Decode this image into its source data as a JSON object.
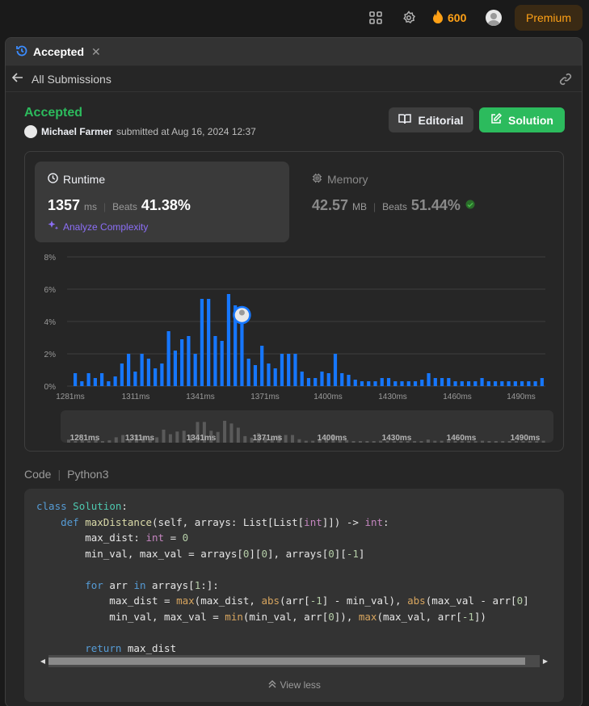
{
  "nav": {
    "streak_count": "600",
    "premium_label": "Premium"
  },
  "tab": {
    "title": "Accepted",
    "close": "✕"
  },
  "subbar": {
    "back_label": "All Submissions"
  },
  "submission": {
    "status": "Accepted",
    "user": "Michael Farmer",
    "submitted_text": "submitted at Aug 16, 2024 12:37"
  },
  "buttons": {
    "editorial": "Editorial",
    "solution": "Solution"
  },
  "runtime": {
    "label": "Runtime",
    "value": "1357",
    "unit": "ms",
    "beats_label": "Beats",
    "beats_value": "41.38%",
    "analyze": "Analyze Complexity"
  },
  "memory": {
    "label": "Memory",
    "value": "42.57",
    "unit": "MB",
    "beats_label": "Beats",
    "beats_value": "51.44%"
  },
  "chart_data": {
    "type": "bar",
    "x_tick_labels": [
      "1281ms",
      "1311ms",
      "1341ms",
      "1371ms",
      "1400ms",
      "1430ms",
      "1460ms",
      "1490ms"
    ],
    "y_tick_labels": [
      "0%",
      "2%",
      "4%",
      "6%",
      "8%"
    ],
    "ylim": [
      0,
      8
    ],
    "values": [
      0.8,
      0.3,
      0.8,
      0.5,
      0.8,
      0.3,
      0.6,
      1.4,
      2.0,
      0.9,
      2.0,
      1.7,
      1.1,
      1.4,
      3.4,
      2.2,
      2.9,
      3.1,
      2.0,
      5.4,
      5.4,
      3.1,
      2.8,
      5.7,
      5.0,
      3.9,
      1.7,
      1.3,
      2.5,
      1.4,
      1.1,
      2.0,
      2.0,
      2.0,
      0.9,
      0.5,
      0.5,
      0.9,
      0.8,
      2.0,
      0.8,
      0.7,
      0.4,
      0.3,
      0.3,
      0.3,
      0.5,
      0.5,
      0.3,
      0.3,
      0.3,
      0.3,
      0.4,
      0.8,
      0.5,
      0.5,
      0.5,
      0.3,
      0.3,
      0.3,
      0.3,
      0.5,
      0.3,
      0.3,
      0.3,
      0.3,
      0.3,
      0.3,
      0.3,
      0.3,
      0.5
    ],
    "highlight_index": 25,
    "bar_color": "#1677ff",
    "grid": true
  },
  "code": {
    "label": "Code",
    "language": "Python3",
    "view_less": "View less",
    "lines": [
      "class Solution:",
      "    def maxDistance(self, arrays: List[List[int]]) -> int:",
      "        max_dist: int = 0",
      "        min_val, max_val = arrays[0][0], arrays[0][-1]",
      "",
      "        for arr in arrays[1:]:",
      "            max_dist = max(max_dist, abs(arr[-1] - min_val), abs(max_val - arr[0]",
      "            min_val, max_val = min(min_val, arr[0]), max(max_val, arr[-1])",
      "",
      "        return max_dist"
    ]
  },
  "colors": {
    "accent_green": "#2cbb5d",
    "brand_orange": "#ffa116",
    "bar_blue": "#1677ff",
    "analyze_purple": "#8c6ff7"
  }
}
